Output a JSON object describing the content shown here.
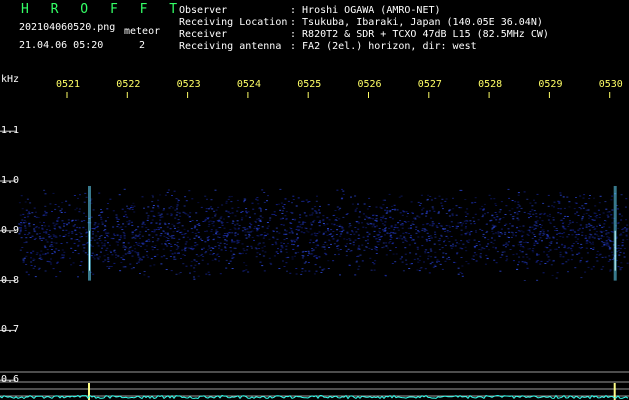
{
  "app": {
    "title": "H R O F F T"
  },
  "file": {
    "name": "202104060520.png",
    "datetime": "21.04.06 05:20"
  },
  "meteor": {
    "label": "meteor",
    "count": "2"
  },
  "info": {
    "observer_label": "Observer",
    "observer_value": ": Hroshi OGAWA (AMRO-NET)",
    "location_label": "Receiving Location",
    "location_value": ": Tsukuba, Ibaraki, Japan (140.05E 36.04N)",
    "receiver_label": "Receiver",
    "receiver_value": ": R820T2 & SDR + TCXO 47dB L15 (82.5MHz CW)",
    "antenna_label": "Receiving antenna",
    "antenna_value": ": FA2 (2el.) horizon, dir: west"
  },
  "chart_data": {
    "type": "heatmap",
    "ylabel": "kHz",
    "y_ticks": [
      "1.1",
      "1.0",
      "0.9",
      "0.8",
      "0.7",
      "0.6"
    ],
    "x_ticks": [
      "0521",
      "0522",
      "0523",
      "0524",
      "0525",
      "0526",
      "0527",
      "0528",
      "0529",
      "0530"
    ],
    "noise_band_khz": [
      0.8,
      0.99
    ],
    "meteor_events": [
      "0521",
      "0530"
    ],
    "colors": {
      "background": "#000000",
      "noise": "#1a2aa0",
      "meteor": "#66ddff",
      "ticks": "#ffff66",
      "trace": "#33ffee"
    }
  }
}
